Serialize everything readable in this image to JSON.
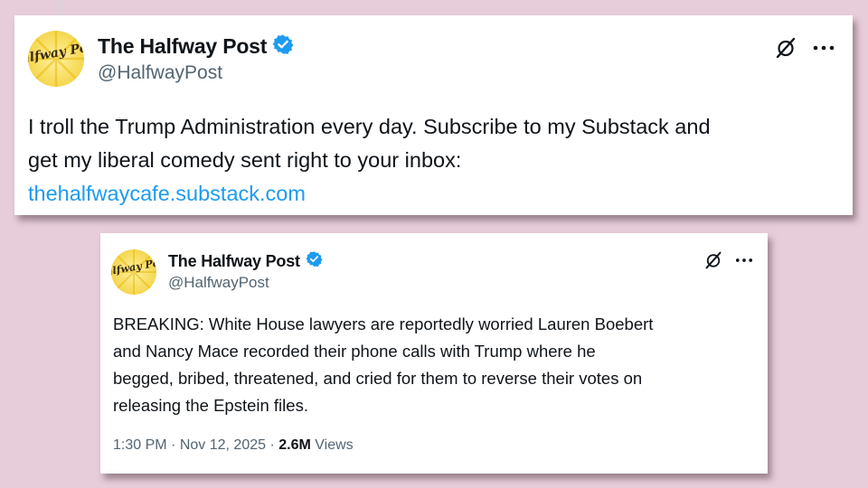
{
  "tweets": [
    {
      "author": {
        "name": "The Halfway Post",
        "handle": "@HalfwayPost",
        "avatar_text": "Halfway Post"
      },
      "text_lines": [
        "I troll the Trump Administration every day. Subscribe to my Substack and",
        "get my liberal comedy sent right to your inbox:"
      ],
      "link": "thehalfwaycafe.substack.com",
      "icons": [
        "grok-icon",
        "more-options-icon",
        "verified-badge-icon"
      ]
    },
    {
      "author": {
        "name": "The Halfway Post",
        "handle": "@HalfwayPost",
        "avatar_text": "Halfway Post"
      },
      "text_lines": [
        "BREAKING: White House lawyers are reportedly worried Lauren Boebert",
        "and Nancy Mace recorded their phone calls with Trump where he",
        "begged, bribed, threatened, and cried for them to reverse their votes on",
        "releasing the Epstein files."
      ],
      "time": "1:30 PM",
      "separator": "·",
      "date": "Nov 12, 2025",
      "views_count": "2.6M",
      "views_label": "Views",
      "icons": [
        "grok-icon",
        "more-options-icon",
        "verified-badge-icon"
      ]
    }
  ],
  "colors": {
    "background": "#e7cdd9",
    "card": "#ffffff",
    "link": "#1d9bf0",
    "verified": "#1d9bf0",
    "secondary_text": "#536471",
    "avatar": "#f1cb2f"
  }
}
